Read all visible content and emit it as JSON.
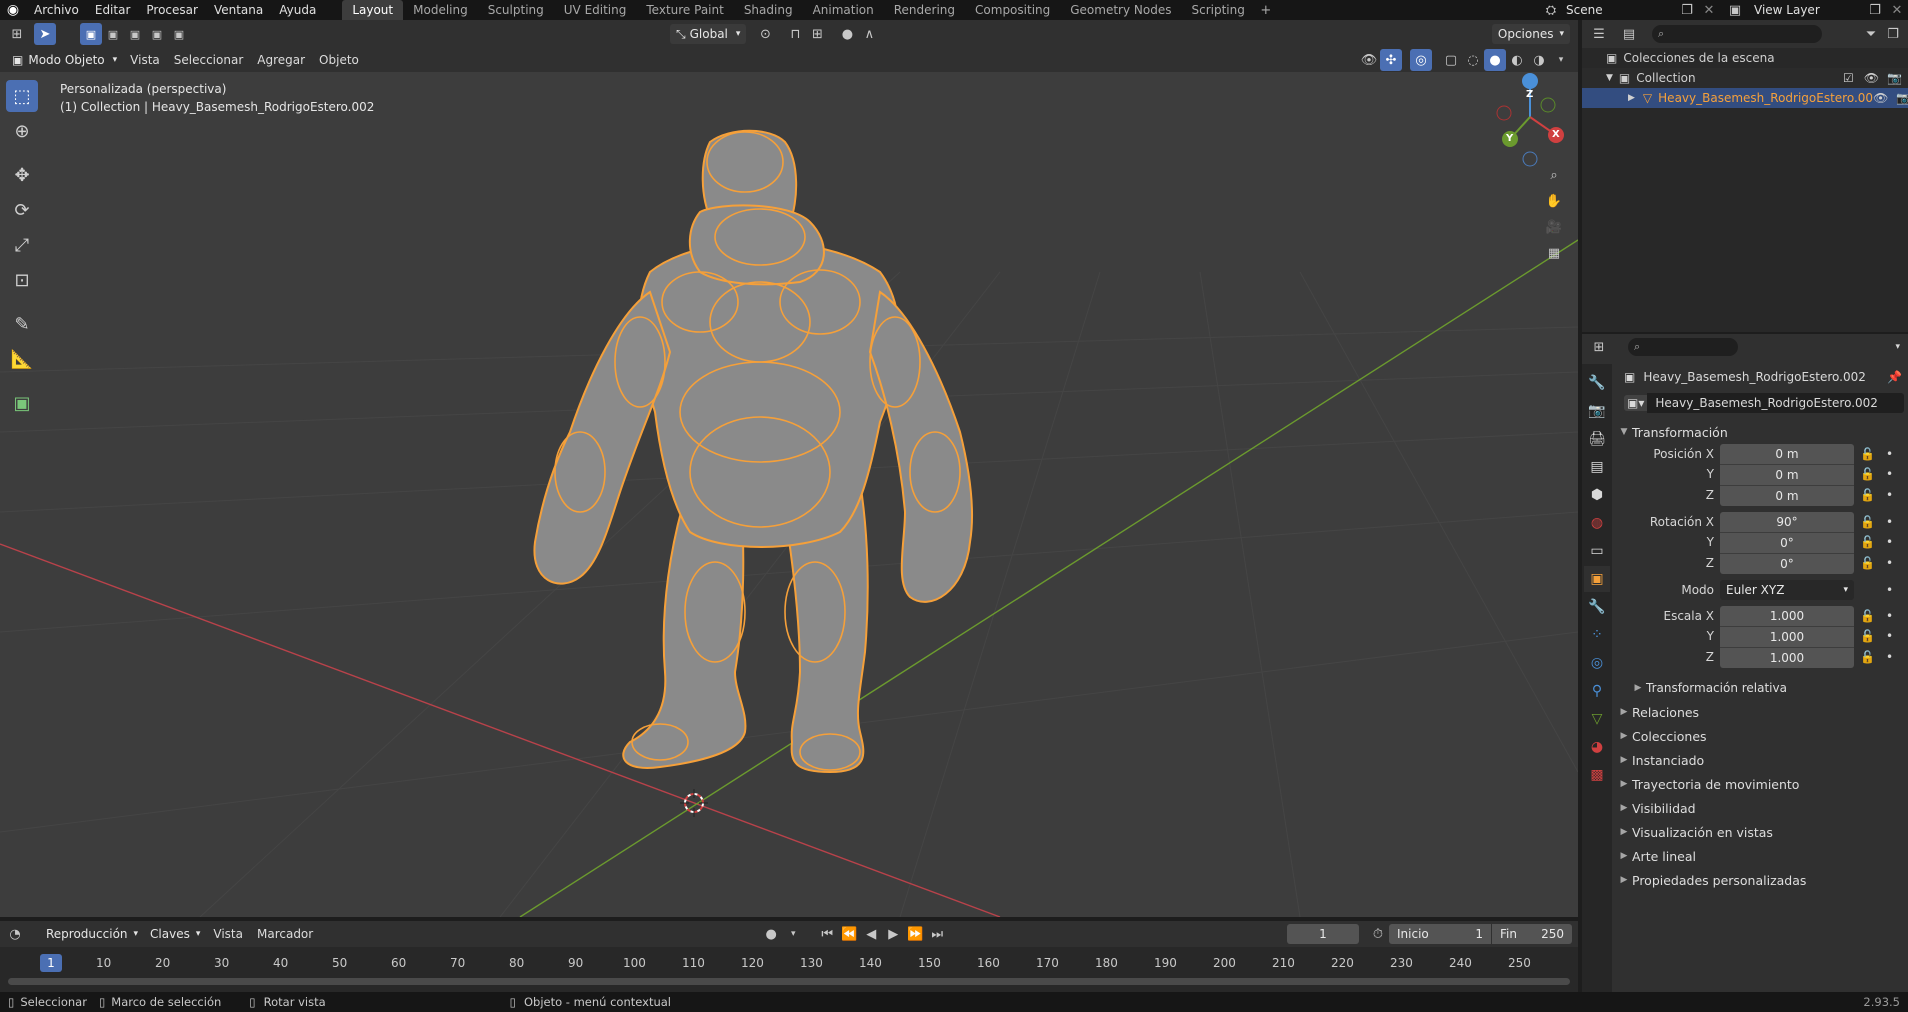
{
  "topbar": {
    "menus": [
      "Archivo",
      "Editar",
      "Procesar",
      "Ventana",
      "Ayuda"
    ],
    "workspaces": [
      "Layout",
      "Modeling",
      "Sculpting",
      "UV Editing",
      "Texture Paint",
      "Shading",
      "Animation",
      "Rendering",
      "Compositing",
      "Geometry Nodes",
      "Scripting"
    ],
    "active_workspace": "Layout",
    "scene_name": "Scene",
    "view_layer_name": "View Layer"
  },
  "viewport": {
    "mode_label": "Modo Objeto",
    "header_menus": [
      "Vista",
      "Seleccionar",
      "Agregar",
      "Objeto"
    ],
    "transform_orientation": "Global",
    "options_label": "Opciones",
    "view_name": "Personalizada (perspectiva)",
    "collection_info": "(1) Collection | Heavy_Basemesh_RodrigoEstero.002",
    "gizmo": {
      "x": "X",
      "y": "Y",
      "z": "Z"
    }
  },
  "outliner": {
    "root_label": "Colecciones de la escena",
    "collection_label": "Collection",
    "object_label": "Heavy_Basemesh_RodrigoEstero.00"
  },
  "properties": {
    "object_title": "Heavy_Basemesh_RodrigoEstero.002",
    "object_name_field": "Heavy_Basemesh_RodrigoEstero.002",
    "transform_header": "Transformación",
    "position": {
      "label": "Posición X",
      "x": "0 m",
      "y": "0 m",
      "z": "0 m"
    },
    "rotation": {
      "label": "Rotación X",
      "x": "90°",
      "y": "0°",
      "z": "0°"
    },
    "mode": {
      "label": "Modo",
      "value": "Euler XYZ"
    },
    "scale": {
      "label": "Escala X",
      "x": "1.000",
      "y": "1.000",
      "z": "1.000"
    },
    "axis_y": "Y",
    "axis_z": "Z",
    "delta_label": "Transformación relativa",
    "panels": [
      "Relaciones",
      "Colecciones",
      "Instanciado",
      "Trayectoria de movimiento",
      "Visibilidad",
      "Visualización en vistas",
      "Arte lineal",
      "Propiedades personalizadas"
    ]
  },
  "timeline": {
    "menus": [
      "Reproducción",
      "Claves",
      "Vista",
      "Marcador"
    ],
    "current_frame": "1",
    "start_label": "Inicio",
    "start_value": "1",
    "end_label": "Fin",
    "end_value": "250",
    "frame_marks": [
      "10",
      "20",
      "30",
      "40",
      "50",
      "60",
      "70",
      "80",
      "90",
      "100",
      "110",
      "120",
      "130",
      "140",
      "150",
      "160",
      "170",
      "180",
      "190",
      "200",
      "210",
      "220",
      "230",
      "240",
      "250"
    ],
    "cursor_frame": "1"
  },
  "statusbar": {
    "select": "Seleccionar",
    "box_select": "Marco de selección",
    "rotate_view": "Rotar vista",
    "context_menu": "Objeto - menú contextual",
    "version": "2.93.5"
  },
  "colors": {
    "accent": "#4b6fb3",
    "selection": "#f5a03a",
    "x_axis": "#b8424a",
    "y_axis": "#6b9a2e"
  }
}
